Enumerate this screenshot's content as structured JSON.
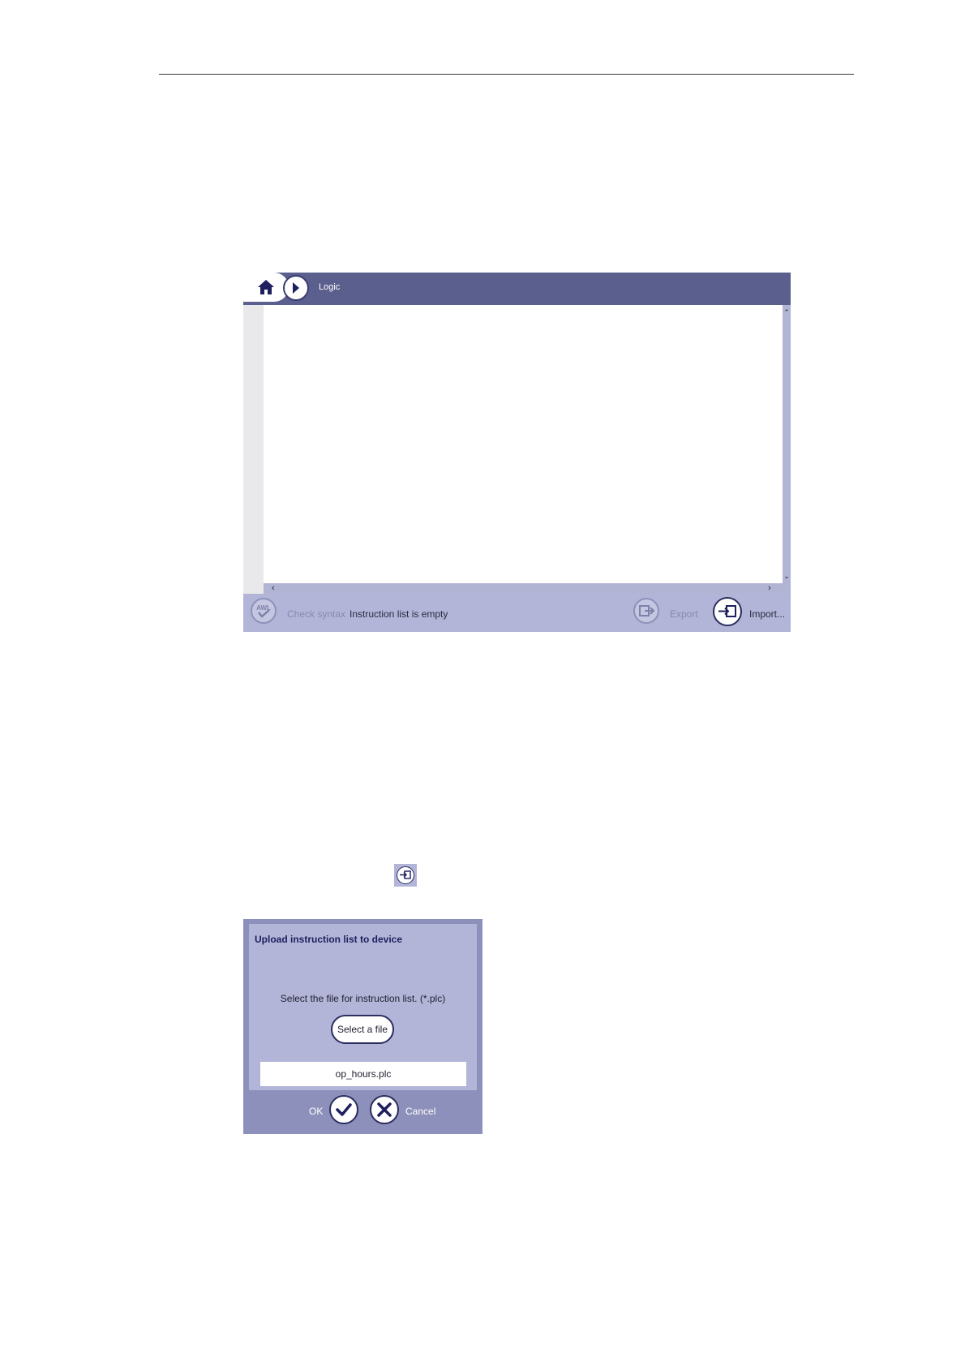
{
  "editor": {
    "breadcrumb": "Logic",
    "icons": {
      "home": "home-icon",
      "next": "chevron-right-icon",
      "check": "awl-check-icon",
      "export": "export-icon",
      "import": "import-icon"
    },
    "footer": {
      "check_label": "Check syntax",
      "status": "Instruction list is empty",
      "export_label": "Export",
      "import_label": "Import..."
    }
  },
  "dialog": {
    "title": "Upload instruction list to device",
    "prompt": "Select the file for instruction list. (*.plc)",
    "select_button": "Select a file",
    "file_value": "op_hours.plc",
    "ok_label": "OK",
    "cancel_label": "Cancel"
  },
  "colors": {
    "header": "#5b5f8e",
    "panel": "#b3b5d8",
    "dark_outline": "#2b2d5e",
    "dialog_frame": "#8d90bb"
  }
}
